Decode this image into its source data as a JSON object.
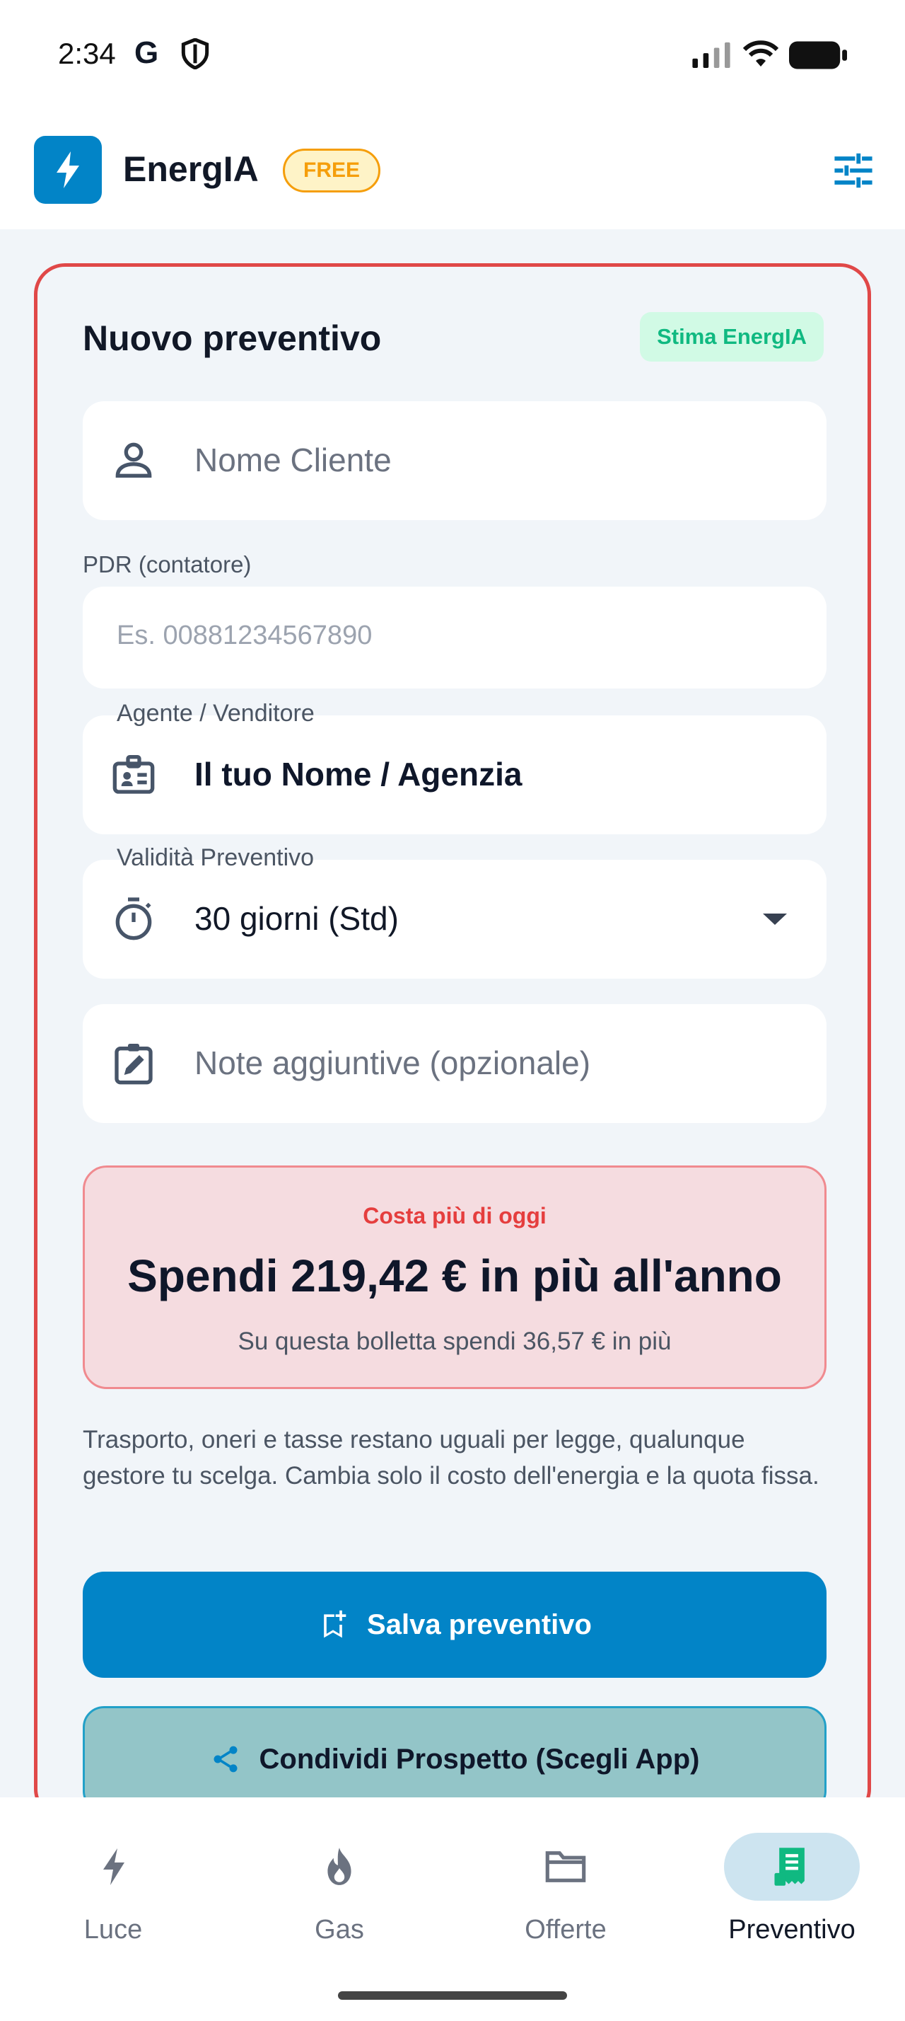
{
  "status_bar": {
    "time": "2:34",
    "g_icon": "G"
  },
  "app_bar": {
    "title": "EnergIA",
    "badge": "FREE",
    "icons": [
      "bolt-icon",
      "tune-icon"
    ]
  },
  "card": {
    "title": "Nuovo preventivo",
    "badge": "Stima EnergIA",
    "client_name": {
      "placeholder": "Nome Cliente"
    },
    "pdr": {
      "label": "PDR (contatore)",
      "placeholder": "Es. 00881234567890"
    },
    "agent": {
      "label": "Agente / Venditore",
      "value": "Il tuo Nome / Agenzia"
    },
    "validity": {
      "label": "Validità Preventivo",
      "value": "30 giorni (Std)"
    },
    "notes": {
      "placeholder": "Note aggiuntive (opzionale)"
    },
    "alert": {
      "top": "Costa più di oggi",
      "main": "Spendi 219,42 € in più all'anno",
      "sub": "Su questa bolletta spendi 36,57 € in più"
    },
    "info": "Trasporto, oneri e tasse restano uguali per legge, qualunque gestore tu scelga. Cambia solo il costo dell'energia e la quota fissa.",
    "save_button": "Salva preventivo",
    "share_button": "Condividi Prospetto (Scegli App)"
  },
  "nav": {
    "items": [
      {
        "label": "Luce",
        "icon": "bolt-icon"
      },
      {
        "label": "Gas",
        "icon": "flame-icon"
      },
      {
        "label": "Offerte",
        "icon": "folder-icon"
      },
      {
        "label": "Preventivo",
        "icon": "receipt-icon"
      }
    ],
    "active": "Preventivo"
  },
  "colors": {
    "primary": "#0284c7",
    "danger": "#e04848",
    "badge_free": "#f59e0b",
    "badge_estimate": "#10b981",
    "active_nav_bg": "#cde4f0",
    "active_nav_icon": "#10b981"
  }
}
